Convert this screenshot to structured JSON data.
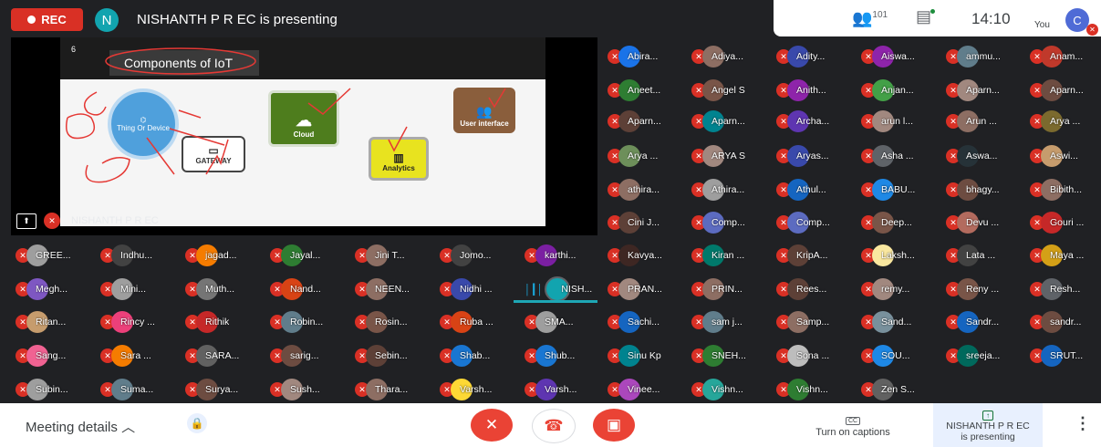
{
  "meeting": {
    "rec_label": "REC",
    "presenter_initial": "N",
    "presenting_title": "NISHANTH P R EC is presenting",
    "participant_count": "101",
    "time": "14:10",
    "self_label": "You",
    "self_initial": "C"
  },
  "slide": {
    "number": "6",
    "title": "Components of IoT",
    "thing_label": "Thing Or Device",
    "cloud_label": "Cloud",
    "gateway_label": "GATEWAY",
    "analytics_label": "Analytics",
    "ui_label": "User interface",
    "presenter_name": "NISHANTH P R EC"
  },
  "participants": [
    {
      "name": "Abira...",
      "color": "#1a73e8"
    },
    {
      "name": "Adiya...",
      "color": "#8d6e63"
    },
    {
      "name": "Adity...",
      "color": "#3949ab"
    },
    {
      "name": "Aiswa...",
      "color": "#8e24aa"
    },
    {
      "name": "ammu...",
      "color": "#607d8b"
    },
    {
      "name": "Anam...",
      "color": "#c0392b"
    },
    {
      "name": "Aneet...",
      "color": "#2e7d32"
    },
    {
      "name": "Angel S",
      "color": "#795548"
    },
    {
      "name": "Anith...",
      "color": "#8e24aa"
    },
    {
      "name": "Anjan...",
      "color": "#43a047"
    },
    {
      "name": "Aparn...",
      "color": "#a1887f"
    },
    {
      "name": "Aparn...",
      "color": "#6d4c41"
    },
    {
      "name": "Aparn...",
      "color": "#5d4037"
    },
    {
      "name": "Aparn...",
      "color": "#00838f"
    },
    {
      "name": "Archa...",
      "color": "#5e35b1"
    },
    {
      "name": "arun l...",
      "color": "#a1887f"
    },
    {
      "name": "Arun ...",
      "color": "#8d6e63"
    },
    {
      "name": "Arya ...",
      "color": "#7b6a2e"
    },
    {
      "name": "Arya ...",
      "color": "#6d8f5a"
    },
    {
      "name": "ARYA S",
      "color": "#a1887f"
    },
    {
      "name": "Aryas...",
      "color": "#3949ab"
    },
    {
      "name": "Asha ...",
      "color": "#5f6368"
    },
    {
      "name": "Aswa...",
      "color": "#263238"
    },
    {
      "name": "Aswi...",
      "color": "#c69c6d"
    },
    {
      "name": "athira...",
      "color": "#8d6e63"
    },
    {
      "name": "Athira...",
      "color": "#9e9e9e"
    },
    {
      "name": "Athul...",
      "color": "#1565c0"
    },
    {
      "name": "BABU...",
      "color": "#1e88e5"
    },
    {
      "name": "bhagy...",
      "color": "#6d4c41"
    },
    {
      "name": "Bibith...",
      "color": "#8d6e63"
    },
    {
      "name": "Cini J...",
      "color": "#5d4037"
    },
    {
      "name": "Comp...",
      "color": "#5c6bc0"
    },
    {
      "name": "Comp...",
      "color": "#5c6bc0"
    },
    {
      "name": "Deep...",
      "color": "#795548"
    },
    {
      "name": "Devu ...",
      "color": "#b36b5e"
    },
    {
      "name": "Gouri ...",
      "color": "#c62828"
    },
    {
      "name": "GREE...",
      "color": "#9e9e9e"
    },
    {
      "name": "Indhu...",
      "color": "#424242"
    },
    {
      "name": "jagad...",
      "color": "#f57c00"
    },
    {
      "name": "Jayal...",
      "color": "#2e7d32"
    },
    {
      "name": "Jini T...",
      "color": "#8d6e63"
    },
    {
      "name": "Jomo...",
      "color": "#424242"
    },
    {
      "name": "karthi...",
      "color": "#7b1fa2"
    },
    {
      "name": "Kavya...",
      "color": "#3e2723"
    },
    {
      "name": "Kiran ...",
      "color": "#00796b"
    },
    {
      "name": "KripA...",
      "color": "#5d4037"
    },
    {
      "name": "Laksh...",
      "color": "#f9e79f"
    },
    {
      "name": "Lata ...",
      "color": "#424242"
    },
    {
      "name": "Maya ...",
      "color": "#d4a017"
    },
    {
      "name": "Megh...",
      "color": "#7e57c2"
    },
    {
      "name": "Mini...",
      "color": "#9e9e9e"
    },
    {
      "name": "Muth...",
      "color": "#757575"
    },
    {
      "name": "Nand...",
      "color": "#d84315"
    },
    {
      "name": "NEEN...",
      "color": "#8d6e63"
    },
    {
      "name": "Nidhi ...",
      "color": "#3949ab"
    },
    {
      "name": "NISH...",
      "color": "#12a4af",
      "active": true
    },
    {
      "name": "PRAN...",
      "color": "#a1887f"
    },
    {
      "name": "PRIN...",
      "color": "#8d6e63"
    },
    {
      "name": "Rees...",
      "color": "#5d4037"
    },
    {
      "name": "remy...",
      "color": "#a1887f"
    },
    {
      "name": "Reny ...",
      "color": "#795548"
    },
    {
      "name": "Resh...",
      "color": "#5f6368"
    },
    {
      "name": "Ritan...",
      "color": "#c69c6d"
    },
    {
      "name": "Rincy ...",
      "color": "#ec407a"
    },
    {
      "name": "Rithik",
      "color": "#c62828"
    },
    {
      "name": "Robin...",
      "color": "#607d8b"
    },
    {
      "name": "Rosin...",
      "color": "#795548"
    },
    {
      "name": "Ruba ...",
      "color": "#d84315"
    },
    {
      "name": "SMA...",
      "color": "#9e9e9e"
    },
    {
      "name": "Sachi...",
      "color": "#1565c0"
    },
    {
      "name": "sam j...",
      "color": "#607d8b"
    },
    {
      "name": "Samp...",
      "color": "#8d6e63"
    },
    {
      "name": "Sand...",
      "color": "#78909c"
    },
    {
      "name": "Sandr...",
      "color": "#1565c0"
    },
    {
      "name": "sandr...",
      "color": "#6d4c41"
    },
    {
      "name": "Sang...",
      "color": "#f06292"
    },
    {
      "name": "Sara ...",
      "color": "#f57c00"
    },
    {
      "name": "SARA...",
      "color": "#616161"
    },
    {
      "name": "sarig...",
      "color": "#6d4c41"
    },
    {
      "name": "Sebin...",
      "color": "#5d4037"
    },
    {
      "name": "Shab...",
      "color": "#1976d2"
    },
    {
      "name": "Shub...",
      "color": "#1976d2"
    },
    {
      "name": "Sinu Kp",
      "color": "#00838f"
    },
    {
      "name": "SNEH...",
      "color": "#2e7d32"
    },
    {
      "name": "Sona ...",
      "color": "#bdbdbd"
    },
    {
      "name": "SOU...",
      "color": "#1e88e5"
    },
    {
      "name": "sreeja...",
      "color": "#00695c"
    },
    {
      "name": "SRUT...",
      "color": "#1565c0"
    },
    {
      "name": "Subin...",
      "color": "#9e9e9e"
    },
    {
      "name": "Suma...",
      "color": "#607d8b"
    },
    {
      "name": "Surya...",
      "color": "#6d4c41"
    },
    {
      "name": "Sush...",
      "color": "#a1887f"
    },
    {
      "name": "Thara...",
      "color": "#8d6e63"
    },
    {
      "name": "Varsh...",
      "color": "#fdd835"
    },
    {
      "name": "Varsh...",
      "color": "#5e35b1"
    },
    {
      "name": "Vinee...",
      "color": "#ab47bc"
    },
    {
      "name": "Vishn...",
      "color": "#26a69a"
    },
    {
      "name": "Vishn...",
      "color": "#2e7d32"
    },
    {
      "name": "Zen S...",
      "color": "#616161"
    }
  ],
  "bottom": {
    "meeting_details": "Meeting details",
    "caption_label": "Turn on captions",
    "caption_icon": "CC",
    "present_name": "NISHANTH P R EC",
    "present_sub": "is presenting"
  }
}
